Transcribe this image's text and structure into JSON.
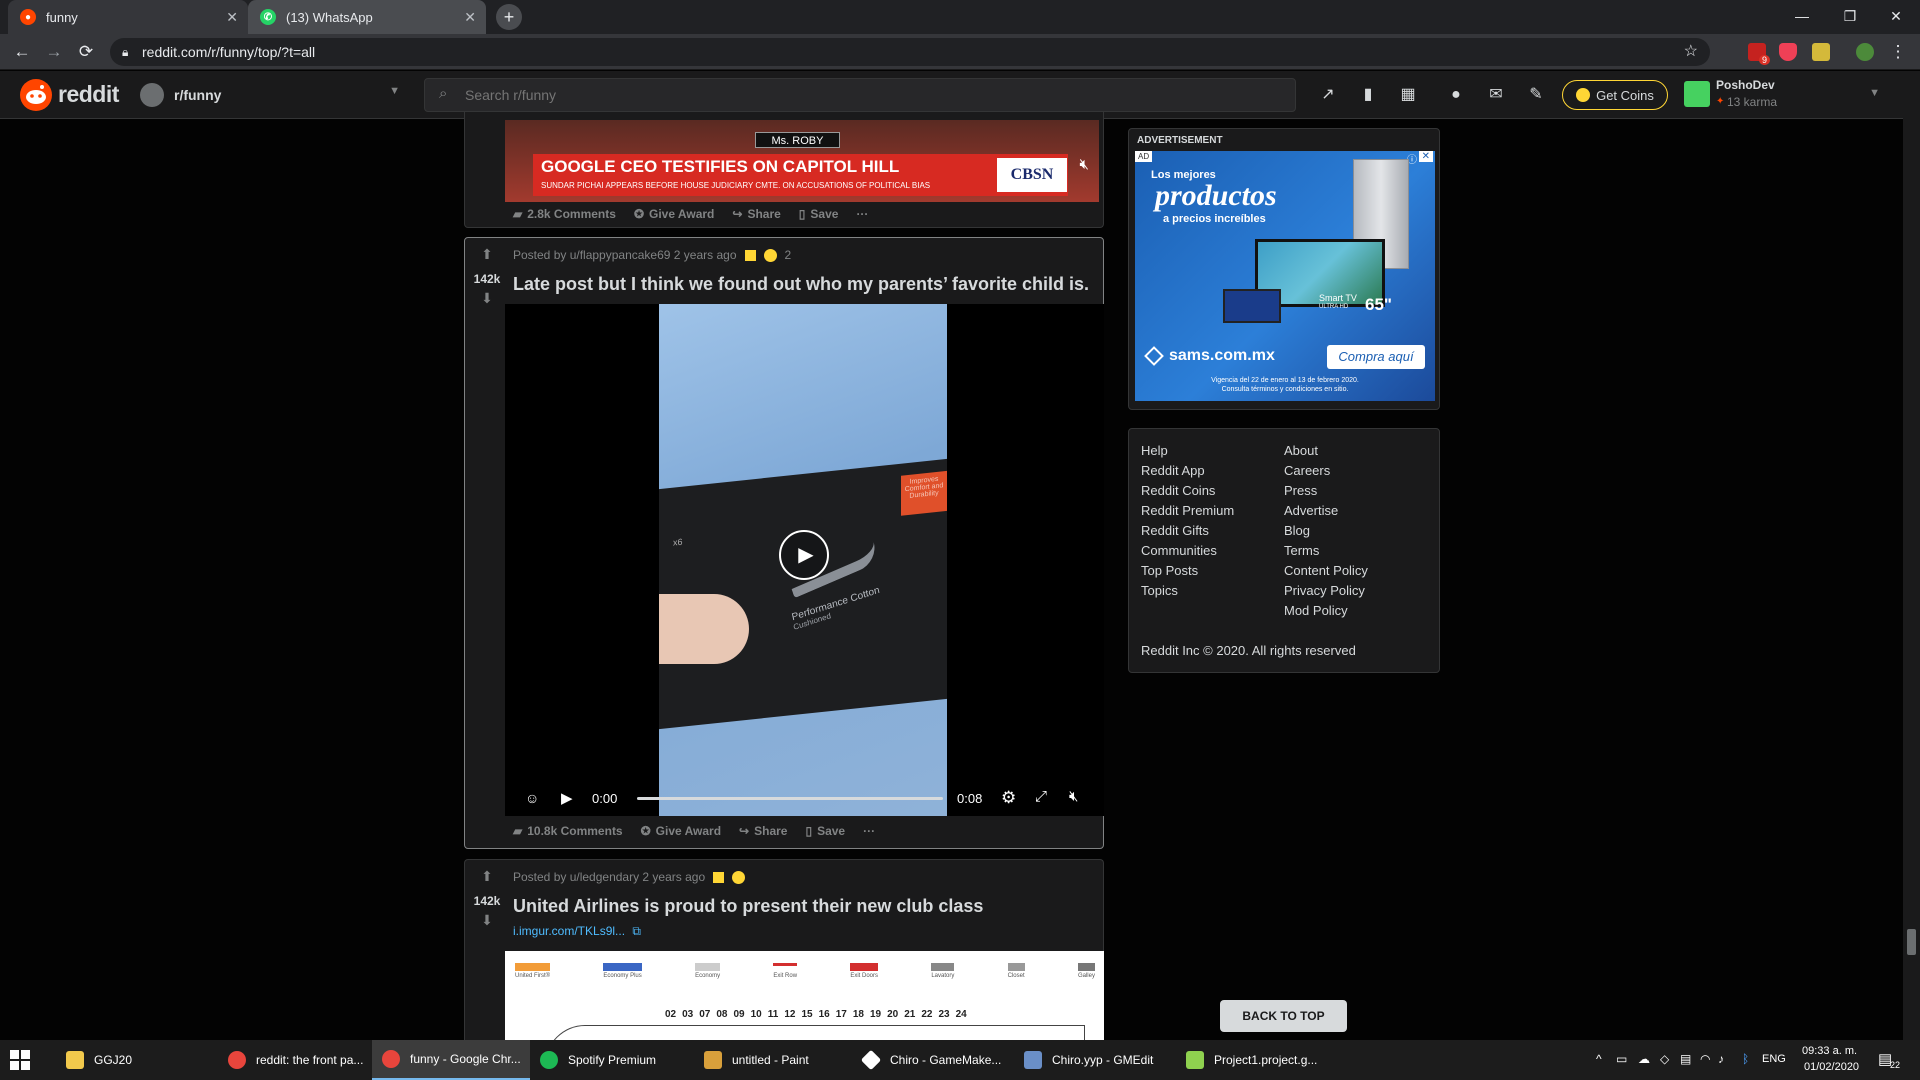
{
  "browser": {
    "tabs": [
      {
        "label": "funny",
        "active": true
      },
      {
        "label": "(13) WhatsApp",
        "active": false
      }
    ],
    "url": "reddit.com/r/funny/top/?t=all",
    "new_tab": "+",
    "gmail_badge": "9"
  },
  "header": {
    "brand": "reddit",
    "community": "r/funny",
    "search_placeholder": "Search r/funny",
    "get_coins": "Get Coins",
    "username": "PoshoDev",
    "karma": "13 karma"
  },
  "posts": [
    {
      "actions": {
        "comments": "2.8k Comments",
        "award": "Give Award",
        "share": "Share",
        "save": "Save"
      },
      "banner_nameplate": "Ms. ROBY",
      "banner_headline": "GOOGLE CEO TESTIFIES ON CAPITOL HILL",
      "banner_sub": "SUNDAR PICHAI APPEARS BEFORE HOUSE JUDICIARY CMTE. ON ACCUSATIONS OF POLITICAL BIAS",
      "banner_network": "CBSN"
    },
    {
      "votes": "142k",
      "posted_by": "Posted by u/flappypancake69 2 years ago",
      "award_count": "2",
      "title": "Late post but I think we found out who my parents’ favorite child is.",
      "video": {
        "current_time": "0:00",
        "duration": "0:08",
        "progress": 0,
        "label_line1": "Performance Cotton",
        "label_line2": "Cushioned",
        "tag_text": "Improves Comfort and Durability",
        "pack_count": "x6"
      },
      "actions": {
        "comments": "10.8k Comments",
        "award": "Give Award",
        "share": "Share",
        "save": "Save"
      }
    },
    {
      "votes": "142k",
      "posted_by": "Posted by u/ledgendary 2 years ago",
      "title": "United Airlines is proud to present their new club class",
      "link": "i.imgur.com/TKLs9l...",
      "seatmap_legend": [
        "United First®",
        "Economy Plus",
        "Economy",
        "Exit Row",
        "Exit Doors",
        "Lavatory",
        "Closet",
        "Galley"
      ],
      "row_numbers": [
        "02",
        "03",
        "07",
        "08",
        "09",
        "10",
        "11",
        "12",
        "15",
        "16",
        "17",
        "18",
        "19",
        "20",
        "21",
        "22",
        "23",
        "24"
      ]
    }
  ],
  "sidebar": {
    "ad_label": "ADVERTISEMENT",
    "ad_badge": "AD",
    "ad_text_1": "Los mejores",
    "ad_text_2": "productos",
    "ad_text_3": "a precios increíbles",
    "ad_tv_label": "Smart TV",
    "ad_tv_sub": "ULTRA HD",
    "ad_tv_size": "65\"",
    "ad_site": "sams.com.mx",
    "ad_cta": "Compra aquí",
    "ad_fine_1": "Vigencia del 22 de enero al 13 de febrero 2020.",
    "ad_fine_2": "Consulta términos y condiciones en sitio.",
    "links_left": [
      "Help",
      "Reddit App",
      "Reddit Coins",
      "Reddit Premium",
      "Reddit Gifts",
      "Communities",
      "Top Posts",
      "Topics"
    ],
    "links_right": [
      "About",
      "Careers",
      "Press",
      "Advertise",
      "Blog",
      "Terms",
      "Content Policy",
      "Privacy Policy",
      "Mod Policy"
    ],
    "copyright": "Reddit Inc © 2020. All rights reserved",
    "back_to_top": "BACK TO TOP"
  },
  "taskbar": {
    "items": [
      {
        "label": "GGJ20",
        "color": "#f2c94c"
      },
      {
        "label": "reddit: the front pa...",
        "color": "#e8453c"
      },
      {
        "label": "funny - Google Chr...",
        "color": "#e8453c"
      },
      {
        "label": "Spotify Premium",
        "color": "#1db954"
      },
      {
        "label": "untitled - Paint",
        "color": "#d9a03b"
      },
      {
        "label": "Chiro - GameMake...",
        "color": "#ffffff"
      },
      {
        "label": "Chiro.yyp - GMEdit",
        "color": "#6a8fc7"
      },
      {
        "label": "Project1.project.g...",
        "color": "#8fd14f"
      }
    ],
    "language": "ENG",
    "time": "09:33 a. m.",
    "date": "01/02/2020",
    "notifications": "22"
  },
  "colors": {
    "reddit_orange": "#ff4500",
    "coins_gold": "#ffd635",
    "link_blue": "#4fbcff"
  }
}
